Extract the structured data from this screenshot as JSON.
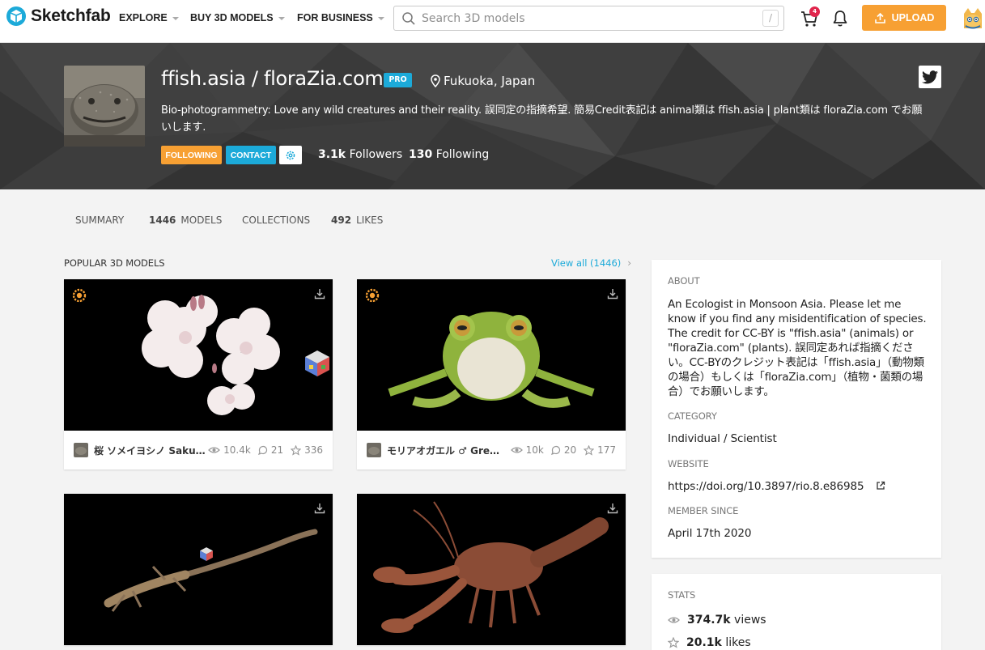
{
  "topnav": {
    "logo_text": "Sketchfab",
    "nav": [
      {
        "label": "EXPLORE"
      },
      {
        "label": "BUY 3D MODELS"
      },
      {
        "label": "FOR BUSINESS"
      }
    ],
    "search_placeholder": "Search 3D models",
    "search_shortcut": "/",
    "cart_badge": "4",
    "upload_label": "UPLOAD",
    "icons": {
      "search": "search-icon",
      "cart": "cart-icon",
      "bell": "bell-icon",
      "upload": "upload-icon"
    }
  },
  "profile": {
    "display_name": "ffish.asia / floraZia.com",
    "pro_badge": "PRO",
    "location": "Fukuoka, Japan",
    "bio": "Bio-photogrammetry: Love any wild creatures and their reality. 誤同定の指摘希望. 簡易Credit表記は animal類は ffish.asia | plant類は floraZia.com でお願いします.",
    "following_label": "FOLLOWING",
    "contact_label": "CONTACT",
    "followers_count": "3.1k",
    "followers_label": "Followers",
    "following_count": "130",
    "following_text": "Following"
  },
  "tabs": [
    {
      "count": "",
      "label": "SUMMARY"
    },
    {
      "count": "1446",
      "label": "MODELS"
    },
    {
      "count": "",
      "label": "COLLECTIONS"
    },
    {
      "count": "492",
      "label": "LIKES"
    }
  ],
  "popular": {
    "title": "POPULAR 3D MODELS",
    "view_all": "View all (1446)",
    "models": [
      {
        "title": "桜 ソメイヨシノ Sakura ...",
        "views": "10.4k",
        "comments": "21",
        "likes": "336"
      },
      {
        "title": "モリアオガエル ♂ Green ...",
        "views": "10k",
        "comments": "20",
        "likes": "177"
      },
      {
        "title": "",
        "views": "",
        "comments": "",
        "likes": ""
      },
      {
        "title": "",
        "views": "",
        "comments": "",
        "likes": ""
      }
    ]
  },
  "about": {
    "about_label": "ABOUT",
    "about_text": "An Ecologist in Monsoon Asia. Please let me know if you find any misidentification of species. The credit for CC-BY is \"ffish.asia\" (animals) or \"floraZia.com\" (plants). 誤同定あれば指摘ください。CC-BYのクレジット表記は「ffish.asia」（動物類の場合）もしくは「floraZia.com」（植物・菌類の場合）でお願いします。",
    "category_label": "CATEGORY",
    "category_value": "Individual / Scientist",
    "website_label": "WEBSITE",
    "website_value": "https://doi.org/10.3897/rio.8.e86985",
    "member_label": "MEMBER SINCE",
    "member_value": "April 17th 2020"
  },
  "stats": {
    "label": "STATS",
    "views_count": "374.7k",
    "views_label": "views",
    "likes_count": "20.1k",
    "likes_label": "likes"
  },
  "colors": {
    "accent_orange": "#f7a033",
    "accent_blue": "#1caad9",
    "header_bg": "#3a3a3a",
    "badge_red": "#e0254c"
  }
}
